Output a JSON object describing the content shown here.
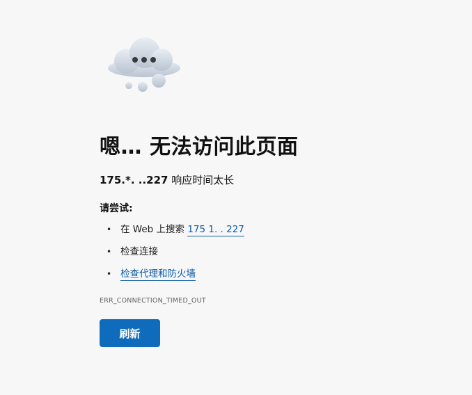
{
  "error_page": {
    "icon": "cloud-with-dots-icon",
    "title": "嗯… 无法访问此页面",
    "host_display": "175.*.  ..227",
    "subtitle_suffix": " 响应时间太长",
    "try_label": "请尝试:",
    "suggestions": [
      {
        "prefix": "在 Web 上搜索 ",
        "link": "175 1.  . 227"
      },
      {
        "text": "检查连接"
      },
      {
        "link": "检查代理和防火墙"
      }
    ],
    "bullet": "•",
    "error_code": "ERR_CONNECTION_TIMED_OUT",
    "refresh_label": "刷新"
  },
  "colors": {
    "background": "#f7f7f7",
    "accent": "#0f6cbd",
    "link": "#0b5aa8"
  }
}
